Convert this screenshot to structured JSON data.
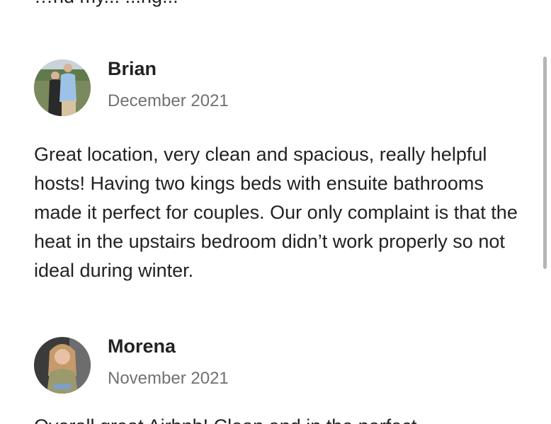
{
  "clipped_top_text": "…nd my... ...ng...",
  "reviews": [
    {
      "name": "Brian",
      "date": "December 2021",
      "text": "Great location, very clean and spacious, really helpful hosts! Having two kings beds with ensuite bathrooms made it perfect for couples. Our only complaint is that the heat in the upstairs bedroom didn’t work properly so not ideal during winter."
    },
    {
      "name": "Morena",
      "date": "November 2021",
      "text": ""
    }
  ],
  "clipped_bottom_text": "Overall great Airbnb! Clean and in the perfect..."
}
